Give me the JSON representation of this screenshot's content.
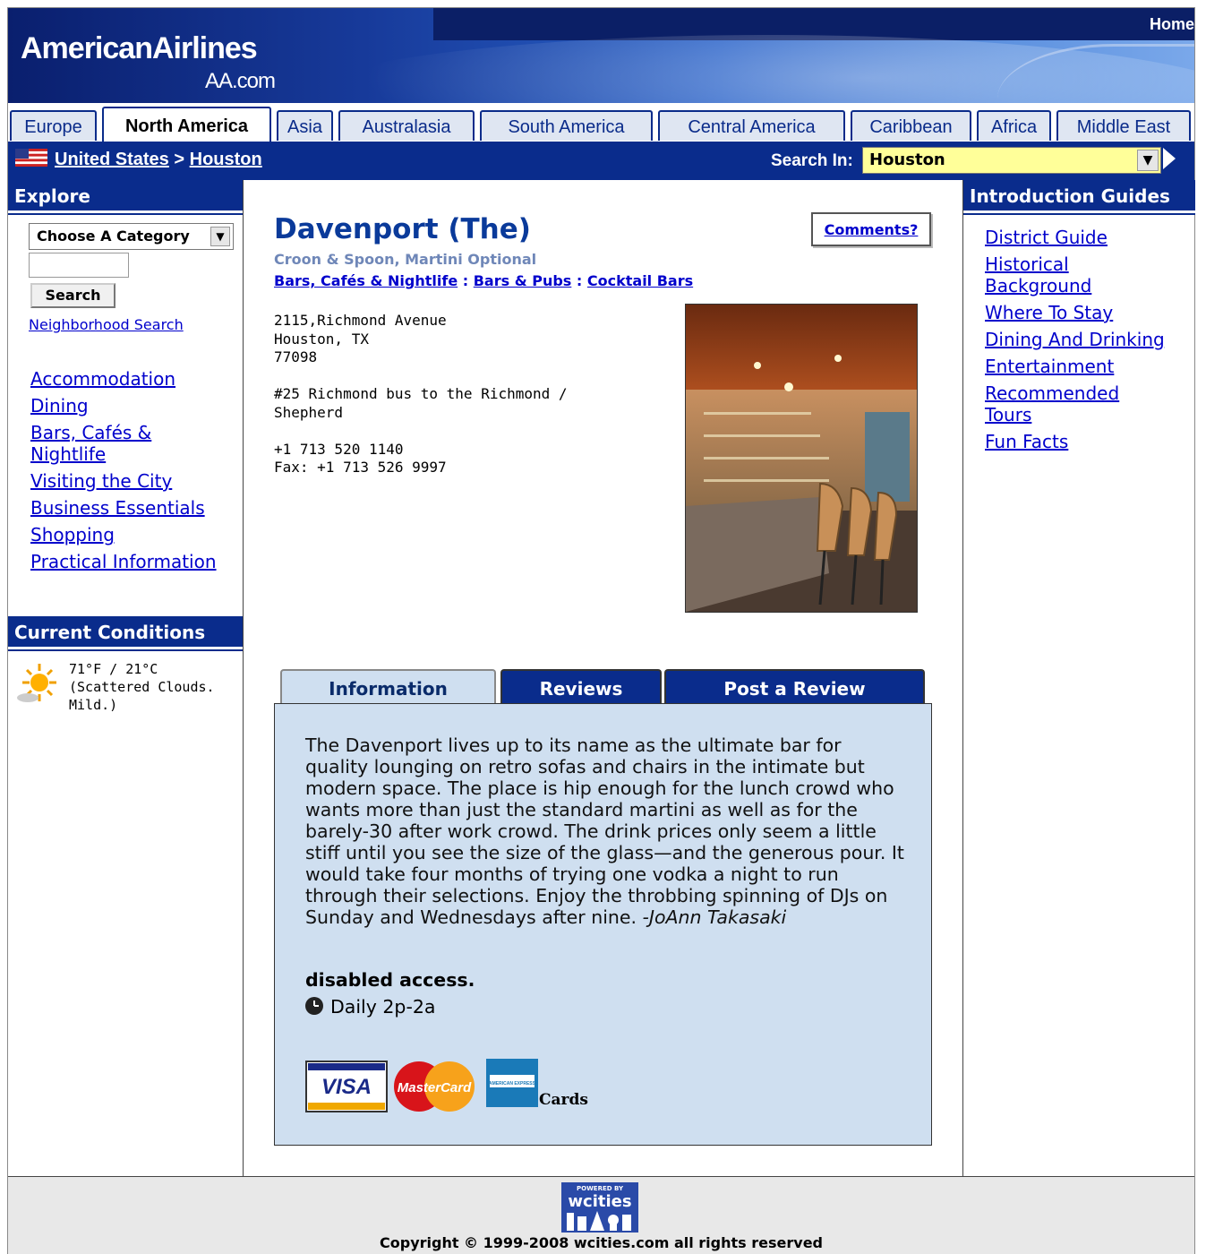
{
  "header": {
    "brand": "AmericanAirlines",
    "brand_sub": "AA.com",
    "home_label": "Home"
  },
  "tabs": [
    {
      "label": "Europe"
    },
    {
      "label": "North America"
    },
    {
      "label": "Asia"
    },
    {
      "label": "Australasia"
    },
    {
      "label": "South America"
    },
    {
      "label": "Central America"
    },
    {
      "label": "Caribbean"
    },
    {
      "label": "Africa"
    },
    {
      "label": "Middle East"
    }
  ],
  "active_tab": "North America",
  "breadcrumb": {
    "country": "United States",
    "separator": ">",
    "city": "Houston"
  },
  "search_in": {
    "label": "Search In:",
    "value": "Houston"
  },
  "explore": {
    "heading": "Explore",
    "category_select": "Choose A Category",
    "search_button": "Search",
    "neighborhood_link": "Neighborhood Search",
    "links": [
      "Accommodation",
      "Dining",
      "Bars, Cafés & Nightlife",
      "Visiting the City",
      "Business Essentials",
      "Shopping",
      "Practical Information"
    ]
  },
  "conditions": {
    "heading": "Current Conditions",
    "temp": "71°F / 21°C",
    "desc1": "(Scattered Clouds.",
    "desc2": "Mild.)",
    "icon": "sun-cloud-icon"
  },
  "guides": {
    "heading": "Introduction Guides",
    "links": [
      "District Guide",
      "Historical Background",
      "Where To Stay",
      "Dining And Drinking",
      "Entertainment",
      "Recommended Tours",
      "Fun Facts"
    ]
  },
  "venue": {
    "name": "Davenport (The)",
    "tagline": "Croon & Spoon, Martini Optional",
    "categories": [
      "Bars, Cafés & Nightlife",
      "Bars & Pubs",
      "Cocktail Bars"
    ],
    "cat_sep": ":",
    "comments_label": "Comments?",
    "address_lines": [
      "2115,Richmond Avenue",
      "Houston, TX",
      "77098",
      "",
      "#25 Richmond bus to the Richmond /",
      "Shepherd",
      "",
      "+1 713 520 1140",
      "Fax: +1 713 526 9997"
    ]
  },
  "info_tabs": [
    "Information",
    "Reviews",
    "Post a Review"
  ],
  "info": {
    "description": "The Davenport lives up to its name as the ultimate bar for quality lounging on retro sofas and chairs in the intimate but modern space. The place is hip enough for the lunch crowd who wants more than just the standard martini as well as for the barely-30 after work crowd. The drink prices only seem a little stiff until you see the size of the glass—and the generous pour. It would take four months of trying one vodka a night to run through their selections. Enjoy the throbbing spinning of DJs on Sunday and Wednesdays after nine.",
    "author": "-JoAnn Takasaki",
    "access": "disabled access.",
    "hours": "Daily 2p-2a",
    "cards": [
      "VISA",
      "MasterCard",
      "AMERICAN EXPRESS"
    ],
    "cards_label": "Cards"
  },
  "footer": {
    "powered_by": "POWERED BY",
    "powered_brand": "wcities",
    "copyright": "Copyright © 1999-2008 wcities.com all rights reserved"
  }
}
